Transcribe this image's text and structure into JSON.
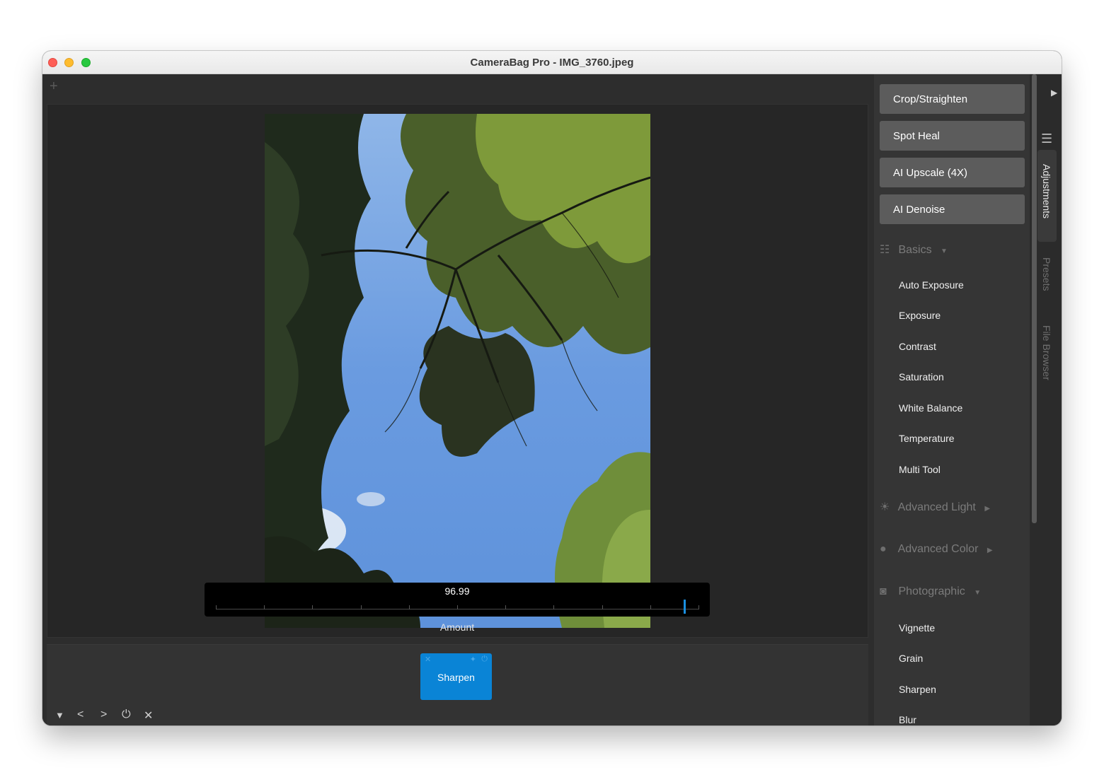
{
  "window": {
    "title": "CameraBag Pro - IMG_3760.jpeg"
  },
  "canvas": {
    "add_tab_label": "+"
  },
  "slider": {
    "value": "96.99",
    "label": "Amount",
    "fraction": 0.97
  },
  "effect_chip": {
    "label": "Sharpen",
    "close_glyph": "✕",
    "pin_glyph": "📌",
    "power_glyph": "⏻"
  },
  "bottom_controls": {
    "collapse": "▼",
    "prev": "<",
    "next": ">",
    "power": "⏻",
    "close": "✕"
  },
  "tools": [
    "Crop/Straighten",
    "Spot Heal",
    "AI Upscale (4X)",
    "AI Denoise"
  ],
  "sections": {
    "basics": {
      "label": "Basics",
      "icon": "sliders-icon",
      "arrow": "▼",
      "items": [
        "Auto Exposure",
        "Exposure",
        "Contrast",
        "Saturation",
        "White Balance",
        "Temperature",
        "Multi Tool"
      ]
    },
    "advanced_light": {
      "label": "Advanced Light",
      "icon": "sun-icon",
      "arrow": "▶"
    },
    "advanced_color": {
      "label": "Advanced Color",
      "icon": "color-circles-icon",
      "arrow": "▶"
    },
    "photographic": {
      "label": "Photographic",
      "icon": "camera-icon",
      "arrow": "▼",
      "items": [
        "Vignette",
        "Grain",
        "Sharpen",
        "Blur"
      ]
    }
  },
  "side_tabs": {
    "adjustments": "Adjustments",
    "presets": "Presets",
    "file_browser": "File Browser",
    "play": "▶",
    "menu": "☰"
  },
  "colors": {
    "accent": "#0a84d6",
    "panel": "#353535",
    "button": "#5c5c5c"
  }
}
